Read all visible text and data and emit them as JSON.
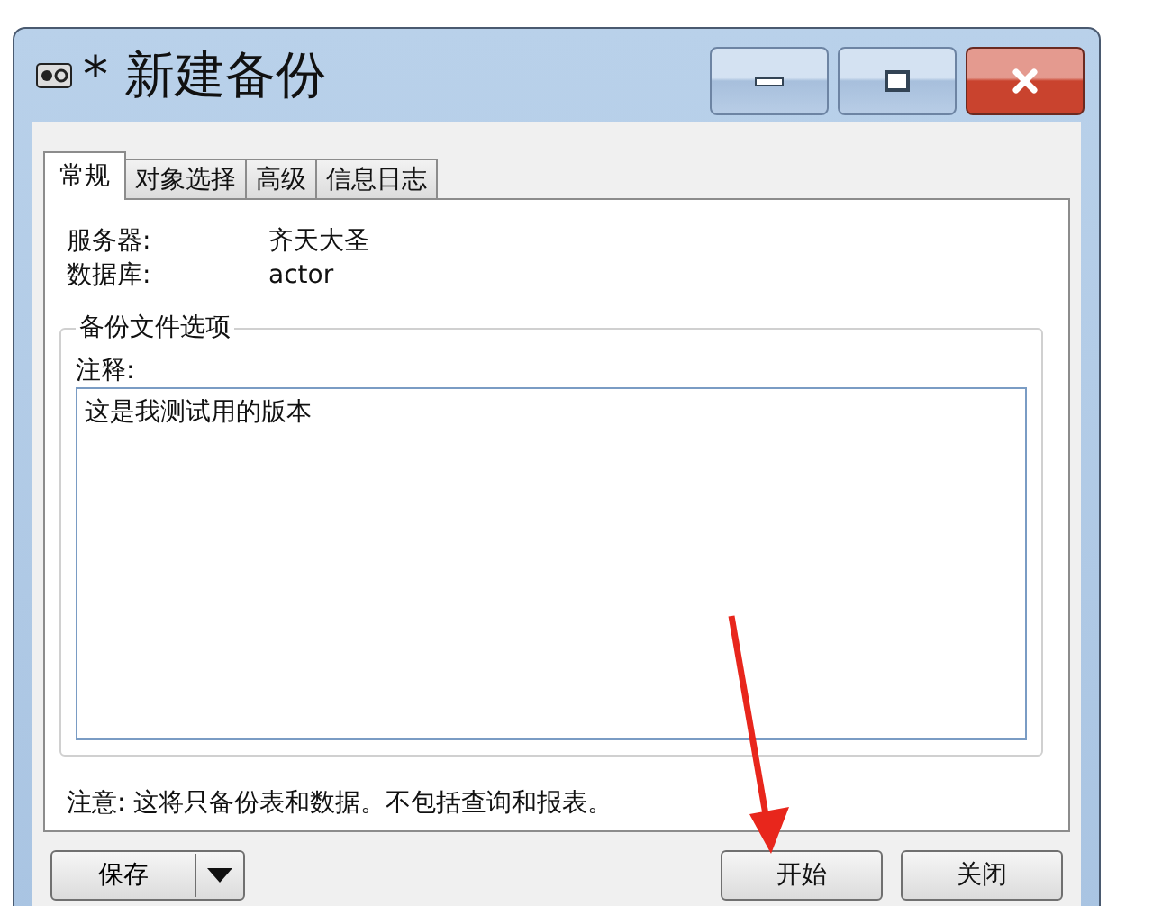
{
  "window": {
    "title": "* 新建备份"
  },
  "tabs": [
    {
      "label": "常规",
      "selected": true
    },
    {
      "label": "对象选择",
      "selected": false
    },
    {
      "label": "高级",
      "selected": false
    },
    {
      "label": "信息日志",
      "selected": false
    }
  ],
  "info": [
    {
      "label": "服务器:",
      "value": "齐天大圣"
    },
    {
      "label": "数据库:",
      "value": "actor"
    }
  ],
  "group": {
    "title": "备份文件选项",
    "comment_label": "注释:",
    "comment_value": "这是我测试用的版本"
  },
  "note": "注意: 这将只备份表和数据。不包括查询和报表。",
  "buttons": {
    "save": "保存",
    "start": "开始",
    "close": "关闭"
  }
}
